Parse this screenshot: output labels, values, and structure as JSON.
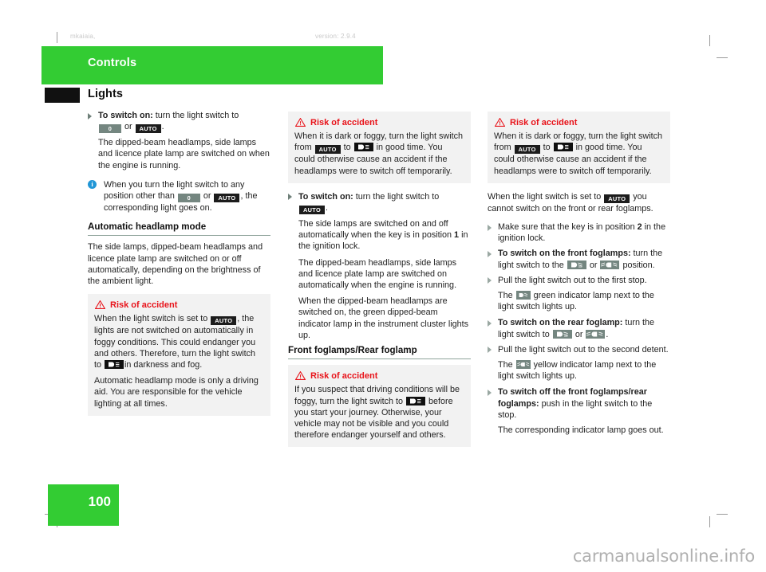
{
  "meta": {
    "running_head_left": "mkaiaia,",
    "running_head_right": "version: 2.9.4",
    "page_number": "100",
    "watermark": "carmanualsonline.info"
  },
  "chapter": {
    "label": "Controls"
  },
  "section": {
    "title": "Lights"
  },
  "icons": {
    "off_label": "0",
    "auto_label": "AUTO",
    "dipped_beam": "dipped-beam-icon",
    "front_foglamp": "front-foglamp-icon",
    "rear_foglamp": "rear-foglamp-icon",
    "front_foglamp_indicator": "front-foglamp-indicator-icon",
    "rear_foglamp_indicator": "rear-foglamp-indicator-icon",
    "info": "i",
    "warning_triangle": "warning-triangle-icon",
    "bullet": "bullet-triangle-icon"
  },
  "colors": {
    "accent_green": "#33cc33",
    "warning_red": "#e8131a",
    "badge_gray": "#748680",
    "badge_dark": "#1c1c1c",
    "info_blue": "#2196d6",
    "box_gray": "#f2f2f2",
    "rule_gray": "#8fa39b"
  },
  "column_left": {
    "b1_bold": "To switch on:",
    "b1_rest": " turn the light switch to",
    "b1_tail": " or",
    "b1_period": ".",
    "p1": "The dipped-beam headlamps, side lamps and licence plate lamp are switched on when the engine is running.",
    "note_a": "When you turn the light switch to any position other than",
    "note_b": "or",
    "note_c": ", the corresponding light goes on.",
    "subhead": "Automatic headlamp mode",
    "p2": "The side lamps, dipped-beam headlamps and licence plate lamp are switched on or off automatically, depending on the brightness of the ambient light.",
    "warning": {
      "title": "Risk of accident",
      "t1a": "When the light switch is set to",
      "t1b": ", the lights are not switched on automatically in foggy conditions. This could endanger you and others. Therefore, turn the light switch to",
      "t1c": "in darkness and fog.",
      "t2": "Automatic headlamp mode is only a driving aid. You are responsible for the vehicle lighting at all times."
    }
  },
  "column_middle": {
    "warning": {
      "title": "Risk of accident",
      "t1a": "When it is dark or foggy, turn the light switch from",
      "t1b": "to",
      "t1c": "in good time. You could otherwise cause an accident if the headlamps were to switch off temporarily."
    },
    "b1_bold": "To switch on:",
    "b1_rest": " turn the light switch to",
    "b1_period": ".",
    "p1a": "The side lamps are switched on and off automatically when the key is in position",
    "p1_num": "1",
    "p1b": "in the ignition lock.",
    "p2": "The dipped-beam headlamps, side lamps and licence plate lamp are switched on automatically when the engine is running.",
    "p3": "When the dipped-beam headlamps are switched on, the green dipped-beam indicator lamp in the instrument cluster lights up.",
    "subhead": "Front foglamps/Rear foglamp",
    "warning2": {
      "title": "Risk of accident",
      "t1a": "If you suspect that driving conditions will be foggy, turn the light switch to",
      "t1b": "before you start your journey. Otherwise, your vehicle may not be visible and you could therefore endanger yourself and others."
    }
  },
  "column_right": {
    "warning": {
      "title": "Risk of accident",
      "t1a": "When it is dark or foggy, turn the light switch from",
      "t1b": "to",
      "t1c": "in good time. You could otherwise cause an accident if the headlamps were to switch off temporarily."
    },
    "p1a": "When the light switch is set to",
    "p1b": "you cannot switch on the front or rear foglamps.",
    "b1a": "Make sure that the key is in position",
    "b1_num": "2",
    "b1b": "in the ignition lock.",
    "b2_bold": "To switch on the front foglamps:",
    "b2_rest": " turn the light switch to the",
    "b2_or": "or",
    "b2_tail": "position.",
    "b3": "Pull the light switch out to the first stop.",
    "s3a": "The",
    "s3b": "green indicator lamp next to the light switch lights up.",
    "b4_bold": "To switch on the rear foglamp:",
    "b4_rest": " turn the light switch to",
    "b4_or": "or",
    "b4_period": ".",
    "b5": "Pull the light switch out to the second detent.",
    "s5a": "The",
    "s5b": "yellow indicator lamp next to the light switch lights up.",
    "b6_bold": "To switch off the front foglamps/rear foglamps:",
    "b6_rest": " push in the light switch to the stop.",
    "s6": "The corresponding indicator lamp goes out."
  }
}
